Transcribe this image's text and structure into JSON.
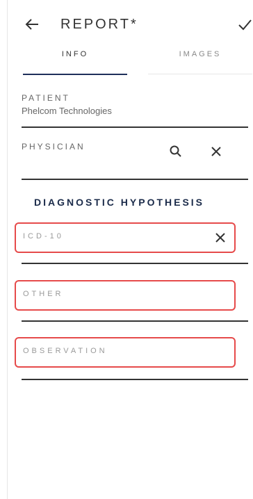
{
  "app_bar": {
    "title": "REPORT*",
    "back_icon": "arrow-left-icon",
    "save_icon": "check-icon"
  },
  "tabs": [
    {
      "label": "INFO",
      "active": true
    },
    {
      "label": "IMAGES",
      "active": false
    }
  ],
  "patient": {
    "label": "PATIENT",
    "value": "Phelcom Technologies"
  },
  "physician": {
    "label": "PHYSICIAN",
    "search_icon": "search-icon",
    "clear_icon": "close-icon"
  },
  "diagnostic": {
    "heading": "DIAGNOSTIC HYPOTHESIS",
    "icd10_placeholder": "ICD-10",
    "other_placeholder": "OTHER",
    "observation_placeholder": "OBSERVATION"
  },
  "colors": {
    "accent": "#1e2f5a",
    "highlight_border": "#e64a4a"
  }
}
